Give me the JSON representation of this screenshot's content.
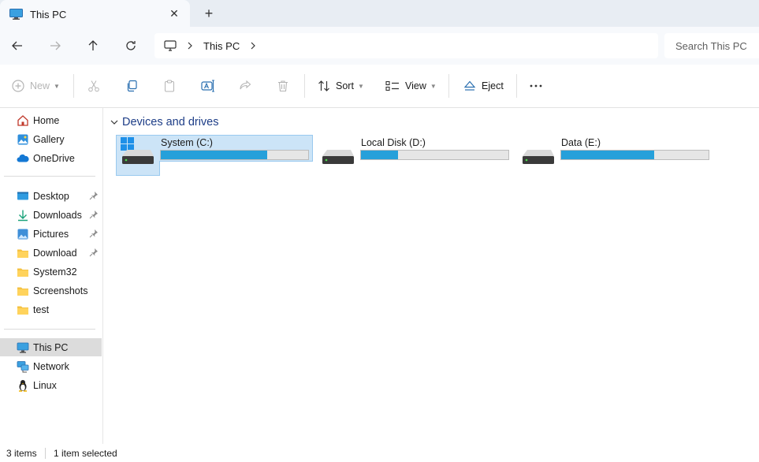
{
  "window": {
    "tab_title": "This PC",
    "tab_icon": "this-pc-icon",
    "new_tab_icon": "plus-icon",
    "close_tab_icon": "close-icon"
  },
  "nav": {
    "back_icon": "arrow-left-icon",
    "forward_icon": "arrow-right-icon",
    "up_icon": "arrow-up-icon",
    "refresh_icon": "refresh-icon",
    "breadcrumb": [
      "This PC"
    ],
    "search_placeholder": "Search This PC"
  },
  "toolbar": {
    "new_label": "New",
    "sort_label": "Sort",
    "view_label": "View",
    "eject_label": "Eject",
    "more_icon": "more-icon",
    "icons": [
      "cut-icon",
      "copy-icon",
      "paste-icon",
      "rename-icon",
      "share-icon",
      "delete-icon"
    ]
  },
  "sidebar": {
    "items": [
      {
        "label": "Home",
        "icon": "home-icon",
        "pinned": false
      },
      {
        "label": "Gallery",
        "icon": "gallery-icon",
        "pinned": false
      },
      {
        "label": "OneDrive",
        "icon": "cloud-icon",
        "pinned": false
      },
      {
        "label": "Desktop",
        "icon": "desktop-icon",
        "pinned": true
      },
      {
        "label": "Downloads",
        "icon": "download-icon",
        "pinned": true
      },
      {
        "label": "Pictures",
        "icon": "pictures-icon",
        "pinned": true
      },
      {
        "label": "Download",
        "icon": "folder-icon",
        "pinned": true
      },
      {
        "label": "System32",
        "icon": "folder-icon",
        "pinned": false
      },
      {
        "label": "Screenshots",
        "icon": "folder-icon",
        "pinned": false
      },
      {
        "label": "test",
        "icon": "folder-icon",
        "pinned": false
      },
      {
        "label": "This PC",
        "icon": "this-pc-icon",
        "pinned": false,
        "selected": true
      },
      {
        "label": "Network",
        "icon": "network-icon",
        "pinned": false
      },
      {
        "label": "Linux",
        "icon": "linux-icon",
        "pinned": false
      }
    ]
  },
  "main": {
    "group_title": "Devices and drives",
    "drives": [
      {
        "name": "System (C:)",
        "used_fraction": 0.72,
        "selected": true,
        "windows_logo": true
      },
      {
        "name": "Local Disk (D:)",
        "used_fraction": 0.25,
        "selected": false,
        "windows_logo": false
      },
      {
        "name": "Data (E:)",
        "used_fraction": 0.63,
        "selected": false,
        "windows_logo": false
      }
    ]
  },
  "status": {
    "item_count": "3 items",
    "selection": "1 item selected"
  },
  "colors": {
    "accent": "#26a0da",
    "selection_bg": "#cce4f7",
    "group_title": "#1d3d87"
  }
}
